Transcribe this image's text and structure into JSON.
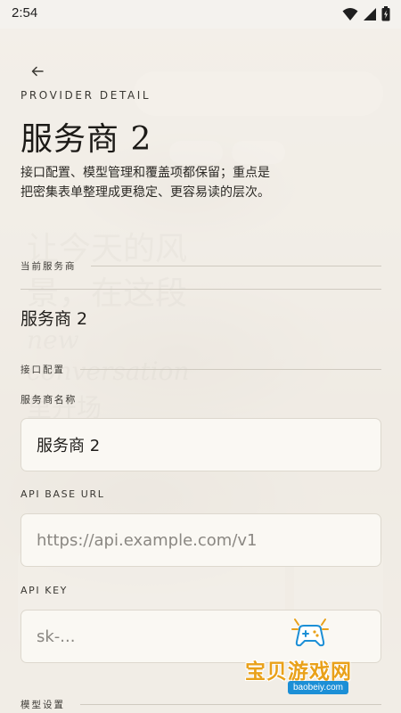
{
  "status_bar": {
    "time": "2:54"
  },
  "header": {
    "eyebrow": "PROVIDER DETAIL",
    "title": "服务商 2",
    "description": "接口配置、模型管理和覆盖项都保留；重点是把密集表单整理成更稳定、更容易读的层次。"
  },
  "current_provider": {
    "label": "当前服务商",
    "value": "服务商 2"
  },
  "interface_config": {
    "section_label": "接口配置",
    "fields": {
      "name": {
        "label": "服务商名称",
        "value": "服务商 2"
      },
      "base_url": {
        "label": "API BASE URL",
        "value": "",
        "placeholder": "https://api.example.com/v1"
      },
      "api_key": {
        "label": "API KEY",
        "value": "",
        "placeholder": "sk-..."
      }
    }
  },
  "model_settings": {
    "section_label": "模型设置"
  },
  "watermark": {
    "text": "宝贝游戏网",
    "url": "baobeiy.com"
  },
  "colors": {
    "background": "#efece4",
    "input_bg": "#faf8f3",
    "watermark_orange": "#e9a11a",
    "watermark_blue": "#1c8fd6"
  }
}
